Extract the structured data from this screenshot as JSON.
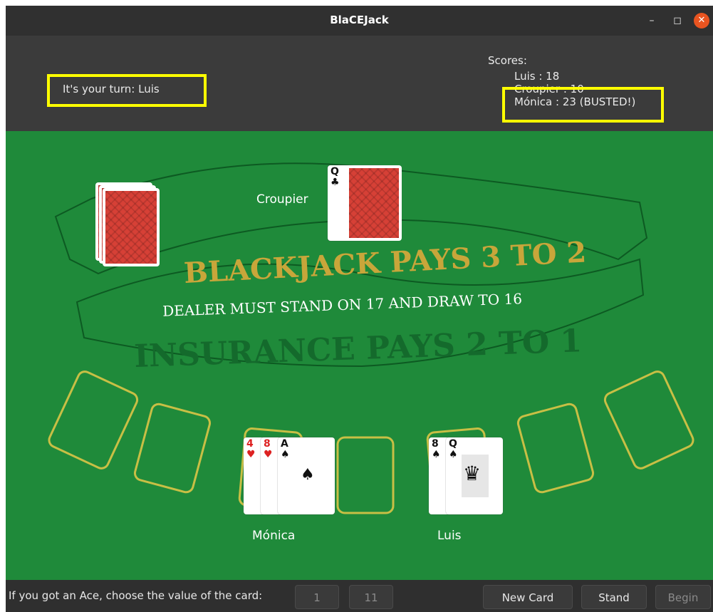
{
  "window": {
    "title": "BlaCEJack",
    "min_icon": "minimize-icon",
    "max_icon": "maximize-icon",
    "close_icon": "close-icon"
  },
  "header": {
    "turn_prefix": "It's your turn:",
    "turn_player": "Luis",
    "scores_label": "Scores:",
    "scores": [
      {
        "text": "Luis : 18"
      },
      {
        "text": "Croupier : 10"
      },
      {
        "text": "Mónica : 23  (BUSTED!)"
      }
    ],
    "highlight_color": "#ffff00"
  },
  "table": {
    "felt_color": "#1f8a3a",
    "banner_top": "BLACKJACK PAYS 3 TO 2",
    "banner_middle": "DEALER MUST STAND ON 17 AND DRAW TO 16",
    "banner_bottom": "INSURANCE PAYS 2 TO 1",
    "croupier_label": "Croupier",
    "players": [
      {
        "name": "Mónica"
      },
      {
        "name": "Luis"
      }
    ],
    "croupier_cards": [
      {
        "rank": "Q",
        "suit": "♣"
      },
      {
        "face_down": true
      }
    ],
    "monica_cards": [
      {
        "rank": "4",
        "suit": "♥"
      },
      {
        "rank": "8",
        "suit": "♥"
      },
      {
        "rank": "A",
        "suit": "♠"
      }
    ],
    "luis_cards": [
      {
        "rank": "8",
        "suit": "♠"
      },
      {
        "rank": "Q",
        "suit": "♠"
      }
    ]
  },
  "controls": {
    "ace_label": "If you got an Ace, choose the value of the card:",
    "ace_one": "1",
    "ace_eleven": "11",
    "new_card": "New Card",
    "stand": "Stand",
    "begin": "Begin"
  }
}
